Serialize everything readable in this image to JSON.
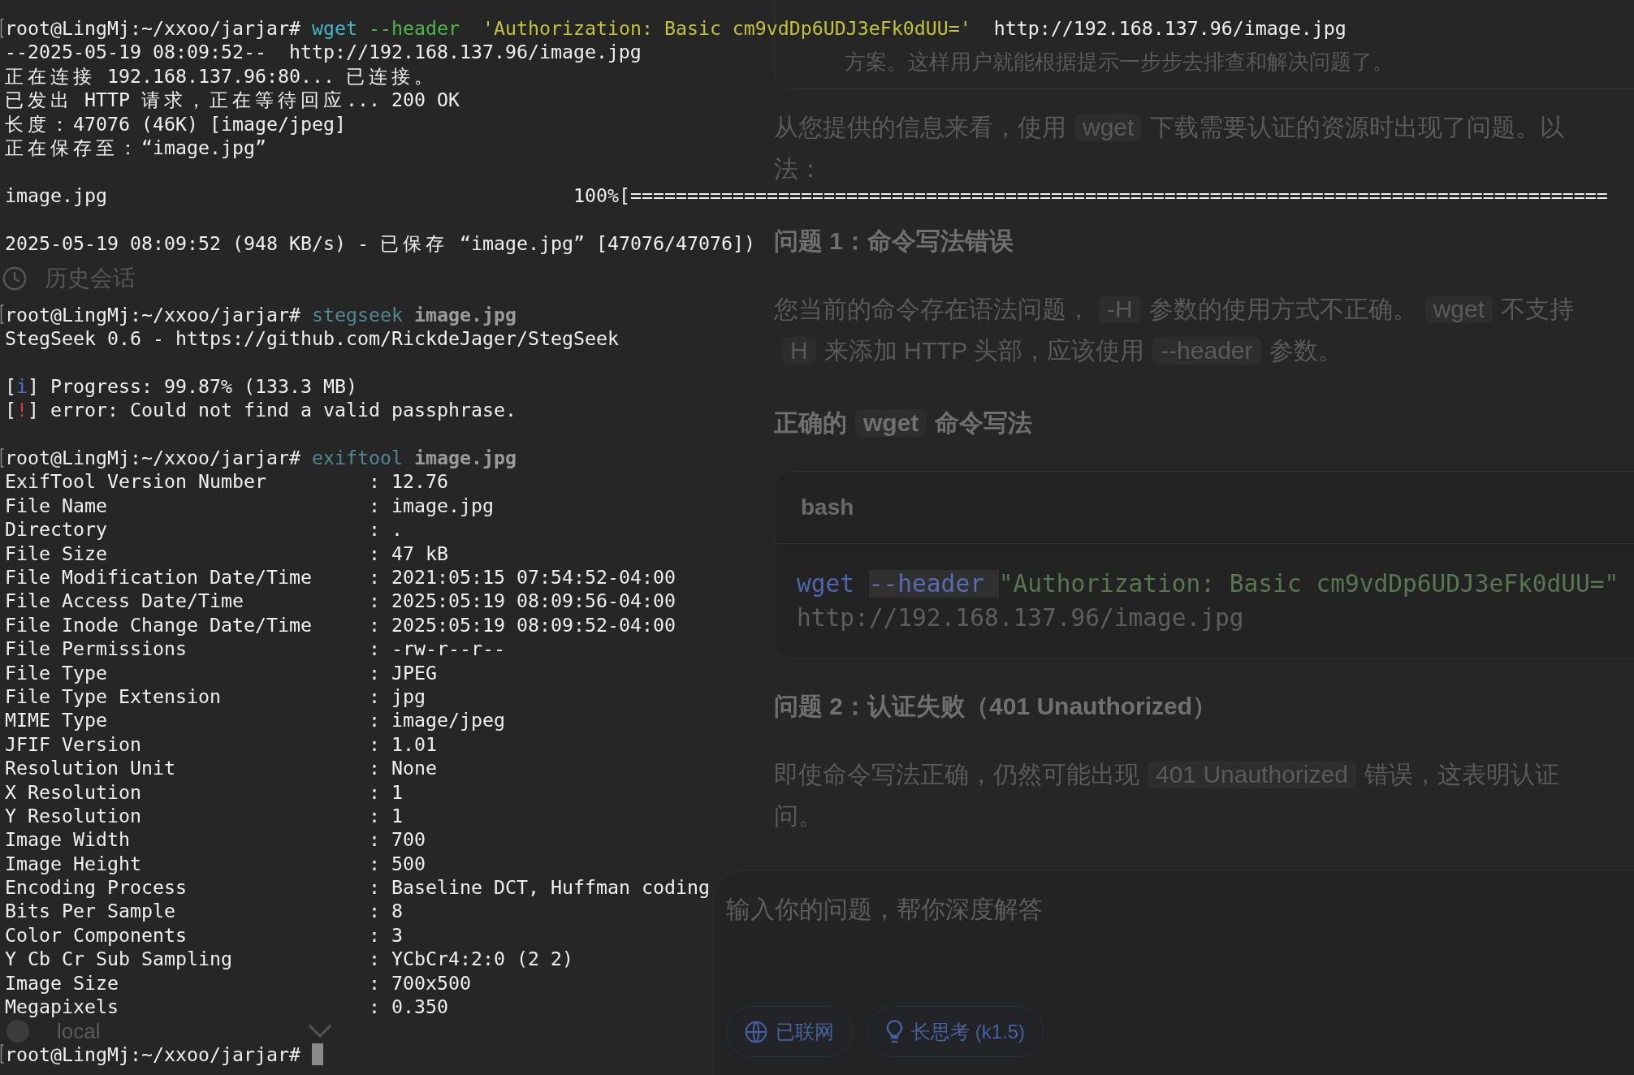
{
  "terminal": {
    "lines": [
      {
        "kind": "command",
        "cursor": false,
        "segments": [
          {
            "text": "root@LingMj:~/xxoo/jarjar# ",
            "kind": "prompt"
          },
          {
            "text": "wget ",
            "kind": "command"
          },
          {
            "text": "--header  ",
            "kind": "option"
          },
          {
            "text": "'Authorization: Basic cm9vdDp6UDJ3eFk0dUU='  ",
            "kind": "string"
          },
          {
            "text": "http://192.168.137.96/image.jpg",
            "kind": "plain"
          }
        ]
      },
      {
        "kind": "output",
        "segments": [
          {
            "text": "--2025-05-19 08:09:52--  http://192.168.137.96/image.jpg",
            "kind": "plain"
          }
        ]
      },
      {
        "kind": "output",
        "segments": [
          {
            "text": "正在连接 192.168.137.96:80... 已连接。",
            "kind": "plain"
          }
        ]
      },
      {
        "kind": "output",
        "segments": [
          {
            "text": "已发出 HTTP 请求，正在等待回应... 200 OK",
            "kind": "plain"
          }
        ]
      },
      {
        "kind": "output",
        "segments": [
          {
            "text": "长度：47076 (46K) [image/jpeg]",
            "kind": "plain"
          }
        ]
      },
      {
        "kind": "output",
        "segments": [
          {
            "text": "正在保存至：“image.jpg”",
            "kind": "plain"
          }
        ]
      },
      {
        "kind": "blank"
      },
      {
        "kind": "transfer",
        "label": "image.jpg",
        "bar": "100%[======================================================================================"
      },
      {
        "kind": "blank"
      },
      {
        "kind": "output",
        "segments": [
          {
            "text": "2025-05-19 08:09:52 (948 KB/s) - 已保存 “image.jpg” [47076/47076])",
            "kind": "plain"
          }
        ]
      },
      {
        "kind": "blank"
      },
      {
        "kind": "blank"
      },
      {
        "kind": "command",
        "cursor": false,
        "segments": [
          {
            "text": "root@LingMj:~/xxoo/jarjar# ",
            "kind": "prompt"
          },
          {
            "text": "stegseek ",
            "kind": "faded"
          },
          {
            "text": "image.jpg",
            "kind": "argument"
          }
        ]
      },
      {
        "kind": "output",
        "segments": [
          {
            "text": "StegSeek 0.6 - https://github.com/RickdeJager/StegSeek",
            "kind": "plain"
          }
        ]
      },
      {
        "kind": "blank"
      },
      {
        "kind": "output",
        "segments": [
          {
            "text": "[",
            "kind": "plain"
          },
          {
            "text": "i",
            "kind": "info"
          },
          {
            "text": "] Progress: 99.87% (133.3 MB)",
            "kind": "plain"
          }
        ]
      },
      {
        "kind": "output",
        "segments": [
          {
            "text": "[",
            "kind": "plain"
          },
          {
            "text": "!",
            "kind": "alert"
          },
          {
            "text": "] error: Could not find a valid passphrase.",
            "kind": "plain"
          }
        ]
      },
      {
        "kind": "blank"
      },
      {
        "kind": "command",
        "cursor": false,
        "segments": [
          {
            "text": "root@LingMj:~/xxoo/jarjar# ",
            "kind": "prompt"
          },
          {
            "text": "exiftool ",
            "kind": "faded"
          },
          {
            "text": "image.jpg",
            "kind": "argument"
          }
        ]
      },
      {
        "kind": "field",
        "label": "ExifTool Version Number",
        "value": ": 12.76"
      },
      {
        "kind": "field",
        "label": "File Name",
        "value": ": image.jpg"
      },
      {
        "kind": "field",
        "label": "Directory",
        "value": ": ."
      },
      {
        "kind": "field",
        "label": "File Size",
        "value": ": 47 kB"
      },
      {
        "kind": "field",
        "label": "File Modification Date/Time",
        "value": ": 2021:05:15 07:54:52-04:00"
      },
      {
        "kind": "field",
        "label": "File Access Date/Time",
        "value": ": 2025:05:19 08:09:56-04:00"
      },
      {
        "kind": "field",
        "label": "File Inode Change Date/Time",
        "value": ": 2025:05:19 08:09:52-04:00"
      },
      {
        "kind": "field",
        "label": "File Permissions",
        "value": ": -rw-r--r--"
      },
      {
        "kind": "field",
        "label": "File Type",
        "value": ": JPEG"
      },
      {
        "kind": "field",
        "label": "File Type Extension",
        "value": ": jpg"
      },
      {
        "kind": "field",
        "label": "MIME Type",
        "value": ": image/jpeg"
      },
      {
        "kind": "field",
        "label": "JFIF Version",
        "value": ": 1.01"
      },
      {
        "kind": "field",
        "label": "Resolution Unit",
        "value": ": None"
      },
      {
        "kind": "field",
        "label": "X Resolution",
        "value": ": 1"
      },
      {
        "kind": "field",
        "label": "Y Resolution",
        "value": ": 1"
      },
      {
        "kind": "field",
        "label": "Image Width",
        "value": ": 700"
      },
      {
        "kind": "field",
        "label": "Image Height",
        "value": ": 500"
      },
      {
        "kind": "field",
        "label": "Encoding Process",
        "value": ": Baseline DCT, Huffman coding"
      },
      {
        "kind": "field",
        "label": "Bits Per Sample",
        "value": ": 8"
      },
      {
        "kind": "field",
        "label": "Color Components",
        "value": ": 3"
      },
      {
        "kind": "field",
        "label": "Y Cb Cr Sub Sampling",
        "value": ": YCbCr4:2:0 (2 2)"
      },
      {
        "kind": "field",
        "label": "Image Size",
        "value": ": 700x500"
      },
      {
        "kind": "field",
        "label": "Megapixels",
        "value": ": 0.350"
      },
      {
        "kind": "blank"
      },
      {
        "kind": "command",
        "cursor": true,
        "segments": [
          {
            "text": "root@LingMj:~/xxoo/jarjar# ",
            "kind": "prompt"
          }
        ]
      }
    ]
  },
  "sidebar": {
    "history_link": {
      "label": "历史会话"
    },
    "account": {
      "name": "local"
    }
  },
  "chat": {
    "reasoning": {
      "text": "方案。这样用户就能根据提示一步步去排查和解决问题了。"
    },
    "blocks": [
      {
        "kind": "paragraph",
        "lines": [
          [
            {
              "text": "从您提供的信息来看，使用",
              "kind": "text"
            },
            {
              "text": "wget",
              "kind": "code"
            },
            {
              "text": "下载需要认证的资源时出现了问题。以",
              "kind": "text"
            }
          ],
          [
            {
              "text": "法：",
              "kind": "text"
            }
          ]
        ]
      },
      {
        "kind": "heading",
        "lines": [
          [
            {
              "text": "问题 1：命令写法错误",
              "kind": "text"
            }
          ]
        ]
      },
      {
        "kind": "paragraph",
        "lines": [
          [
            {
              "text": "您当前的命令存在语法问题，",
              "kind": "text"
            },
            {
              "text": "-H",
              "kind": "code"
            },
            {
              "text": "参数的使用方式不正确。",
              "kind": "text"
            },
            {
              "text": "wget",
              "kind": "code"
            },
            {
              "text": "不支持",
              "kind": "text"
            }
          ],
          [
            {
              "text": "H",
              "kind": "code"
            },
            {
              "text": "来添加 HTTP 头部，应该使用",
              "kind": "text"
            },
            {
              "text": "--header",
              "kind": "code"
            },
            {
              "text": "参数。",
              "kind": "text"
            }
          ]
        ]
      },
      {
        "kind": "heading",
        "lines": [
          [
            {
              "text": "正确的",
              "kind": "text"
            },
            {
              "text": "wget",
              "kind": "code"
            },
            {
              "text": "命令写法",
              "kind": "text"
            }
          ]
        ]
      },
      {
        "kind": "code",
        "language": "bash",
        "lines": [
          [
            {
              "text": "wget ",
              "kind": "keyword"
            },
            {
              "text": "--header ",
              "kind": "option"
            },
            {
              "text": "\"Authorization: Basic cm9vdDp6UDJ3eFk0dUU=\"",
              "kind": "string"
            }
          ],
          [
            {
              "text": "http://192.168.137.96/image.jpg",
              "kind": "plain"
            }
          ]
        ]
      },
      {
        "kind": "heading",
        "lines": [
          [
            {
              "text": "问题 2：认证失败（401 Unauthorized）",
              "kind": "text"
            }
          ]
        ]
      },
      {
        "kind": "paragraph",
        "lines": [
          [
            {
              "text": "即使命令写法正确，仍然可能出现",
              "kind": "text"
            },
            {
              "text": "401 Unauthorized",
              "kind": "code"
            },
            {
              "text": "错误，这表明认证",
              "kind": "text"
            }
          ],
          [
            {
              "text": "问。",
              "kind": "text"
            }
          ]
        ]
      }
    ],
    "composer": {
      "placeholder": "输入你的问题，帮你深度解答",
      "buttons": [
        {
          "label": "已联网",
          "kind": "web"
        },
        {
          "label": "长思考 (k1.5)",
          "kind": "thinking"
        }
      ]
    }
  }
}
